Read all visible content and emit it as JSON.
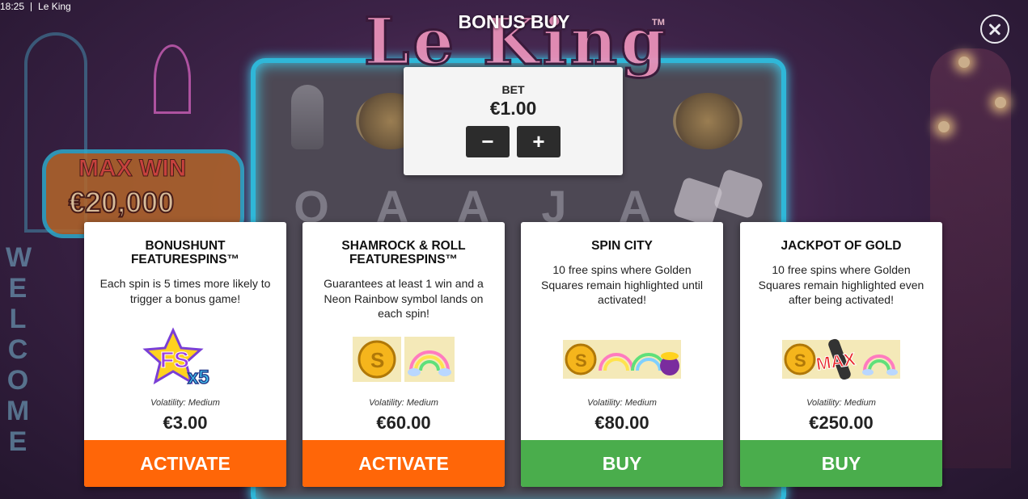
{
  "status_bar": {
    "time": "18:25",
    "app_name": "Le King"
  },
  "header": {
    "title": "BONUS BUY"
  },
  "background": {
    "logo": "Le King",
    "trademark": "TM",
    "max_win_label": "MAX WIN",
    "max_win_value": "€20,000",
    "welcome_text": "WELCOME"
  },
  "bet": {
    "label": "BET",
    "value": "€1.00",
    "minus_label": "−",
    "plus_label": "+"
  },
  "cards": [
    {
      "title": "BONUSHUNT FEATURESPINS™",
      "description": "Each spin is 5 times more likely to trigger a bonus game!",
      "icon": "fs-x5-icon",
      "icon_text": "FS",
      "icon_mult": "x5",
      "volatility": "Volatility: Medium",
      "price": "€3.00",
      "button": "ACTIVATE"
    },
    {
      "title": "SHAMROCK & ROLL FEATURESPINS™",
      "description": "Guarantees at least 1 win and a Neon Rainbow symbol lands on each spin!",
      "icon": "coin-rainbow-icon",
      "volatility": "Volatility: Medium",
      "price": "€60.00",
      "button": "ACTIVATE"
    },
    {
      "title": "SPIN CITY",
      "description": "10 free spins where Golden Squares remain highlighted until activated!",
      "icon": "coin-rainbow-pot-icon",
      "volatility": "Volatility: Medium",
      "price": "€80.00",
      "button": "BUY"
    },
    {
      "title": "JACKPOT OF GOLD",
      "description": "10 free spins where Golden Squares remain highlighted even after being activated!",
      "icon": "coin-max-rainbow-icon",
      "icon_text": "MAX",
      "volatility": "Volatility: Medium",
      "price": "€250.00",
      "button": "BUY"
    }
  ],
  "colors": {
    "activate": "#ff6608",
    "buy": "#4aad4c",
    "bet_panel": "#f4f4f4"
  }
}
